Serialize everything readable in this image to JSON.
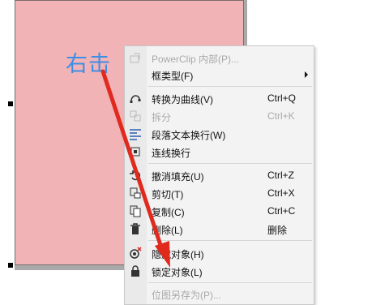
{
  "annotation": {
    "text": "右击",
    "color": "#3d8ee6",
    "arrow_color": "#e02a1e"
  },
  "canvas": {
    "shape_fill": "#f1b3b5"
  },
  "menu": {
    "items": [
      {
        "label": "PowerClip 内部(P)...",
        "shortcut": "",
        "disabled": true,
        "icon": "powerclip-icon"
      },
      {
        "label": "框类型(F)",
        "shortcut": "",
        "disabled": false,
        "submenu": true,
        "icon": ""
      },
      {
        "label": "转换为曲线(V)",
        "shortcut": "Ctrl+Q",
        "disabled": false,
        "icon": "convert-curve-icon"
      },
      {
        "label": "拆分",
        "shortcut": "Ctrl+K",
        "disabled": true,
        "icon": "break-apart-icon"
      },
      {
        "label": "段落文本换行(W)",
        "shortcut": "",
        "disabled": false,
        "icon": "text-wrap-icon"
      },
      {
        "label": "连线换行",
        "shortcut": "",
        "disabled": false,
        "icon": "connector-wrap-icon"
      },
      {
        "label": "撤消填充(U)",
        "shortcut": "Ctrl+Z",
        "disabled": false,
        "icon": "undo-icon"
      },
      {
        "label": "剪切(T)",
        "shortcut": "Ctrl+X",
        "disabled": false,
        "icon": "cut-icon"
      },
      {
        "label": "复制(C)",
        "shortcut": "Ctrl+C",
        "disabled": false,
        "icon": "copy-icon"
      },
      {
        "label": "删除(L)",
        "shortcut": "删除",
        "disabled": false,
        "icon": "trash-icon"
      },
      {
        "label": "隐藏对象(H)",
        "shortcut": "",
        "disabled": false,
        "icon": "hide-object-icon"
      },
      {
        "label": "锁定对象(L)",
        "shortcut": "",
        "disabled": false,
        "icon": "lock-icon"
      },
      {
        "label": "位图另存为(P)...",
        "shortcut": "",
        "disabled": true,
        "icon": ""
      }
    ]
  }
}
